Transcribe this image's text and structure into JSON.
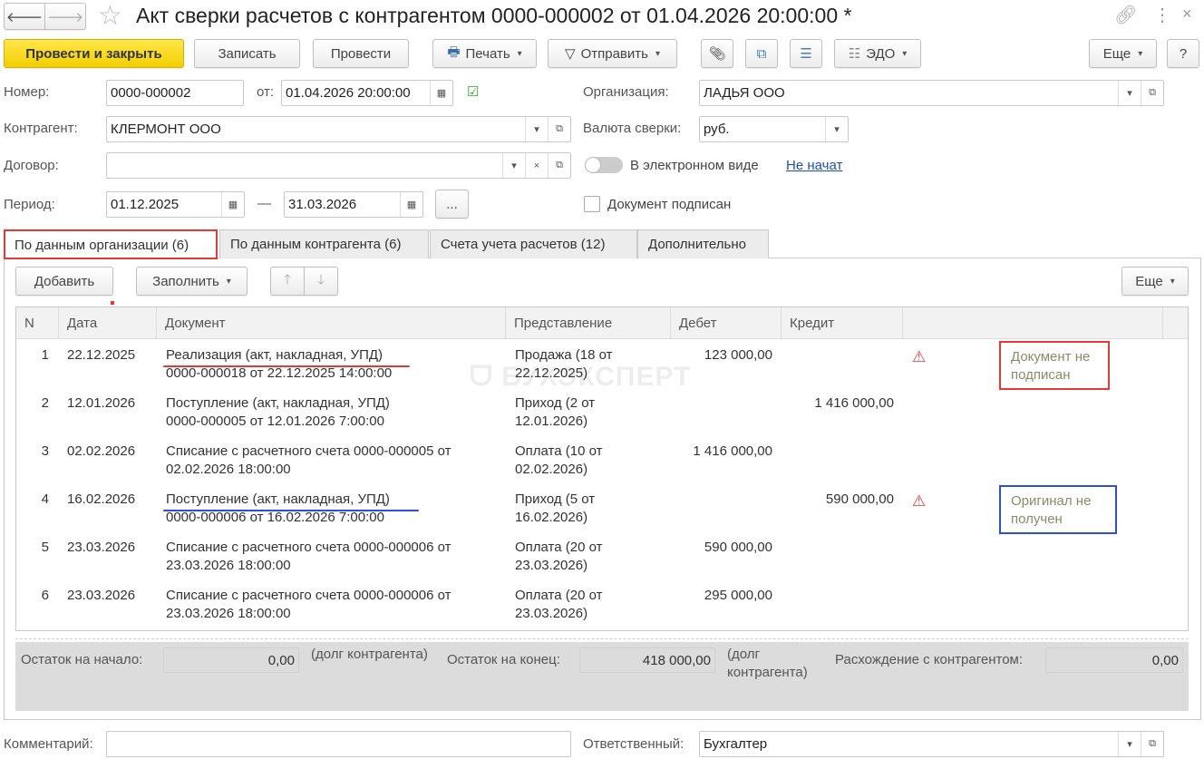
{
  "window": {
    "title": "Акт сверки расчетов с контрагентом 0000-000002 от 01.04.2026 20:00:00 *"
  },
  "toolbar": {
    "post_close": "Провести и закрыть",
    "save": "Записать",
    "post": "Провести",
    "print": "Печать",
    "send": "Отправить",
    "edo": "ЭДО",
    "more": "Еще",
    "help": "?"
  },
  "form": {
    "number_label": "Номер:",
    "number": "0000-000002",
    "date_label": "от:",
    "date": "01.04.2026 20:00:00",
    "org_label": "Организация:",
    "org": "ЛАДЬЯ ООО",
    "counterparty_label": "Контрагент:",
    "counterparty": "КЛЕРМОНТ ООО",
    "currency_label": "Валюта сверки:",
    "currency": "руб.",
    "contract_label": "Договор:",
    "contract": "",
    "electronic_label": "В электронном виде",
    "electronic_status": "Не начат",
    "period_label": "Период:",
    "period_from": "01.12.2025",
    "period_dash": "—",
    "period_to": "31.03.2026",
    "period_btn": "...",
    "signed_label": "Документ подписан"
  },
  "tabs": [
    {
      "label": "По данным организации (6)"
    },
    {
      "label": "По данным контрагента (6)"
    },
    {
      "label": "Счета учета расчетов (12)"
    },
    {
      "label": "Дополнительно"
    }
  ],
  "table_toolbar": {
    "add": "Добавить",
    "fill": "Заполнить",
    "more": "Еще"
  },
  "table": {
    "headers": [
      "N",
      "Дата",
      "Документ",
      "Представление",
      "Дебет",
      "Кредит"
    ],
    "rows": [
      {
        "n": "1",
        "date": "22.12.2025",
        "doc1": "Реализация (акт, накладная, УПД)",
        "doc2": "0000-000018 от 22.12.2025 14:00:00",
        "rep1": "Продажа (18 от",
        "rep2": "22.12.2025)",
        "debit": "123 000,00",
        "credit": "",
        "warn": true,
        "note": "Документ не подписан"
      },
      {
        "n": "2",
        "date": "12.01.2026",
        "doc1": "Поступление (акт, накладная, УПД)",
        "doc2": "0000-000005 от 12.01.2026 7:00:00",
        "rep1": "Приход (2 от",
        "rep2": "12.01.2026)",
        "debit": "",
        "credit": "1 416 000,00"
      },
      {
        "n": "3",
        "date": "02.02.2026",
        "doc1": "Списание с расчетного счета 0000-000005 от",
        "doc2": "02.02.2026 18:00:00",
        "rep1": "Оплата (10 от",
        "rep2": "02.02.2026)",
        "debit": "1 416 000,00",
        "credit": ""
      },
      {
        "n": "4",
        "date": "16.02.2026",
        "doc1": "Поступление (акт, накладная, УПД)",
        "doc2": "0000-000006 от 16.02.2026 7:00:00",
        "rep1": "Приход (5 от",
        "rep2": "16.02.2026)",
        "debit": "",
        "credit": "590 000,00",
        "warn": true,
        "note": "Оригинал не получен"
      },
      {
        "n": "5",
        "date": "23.03.2026",
        "doc1": "Списание с расчетного счета 0000-000006 от",
        "doc2": "23.03.2026 18:00:00",
        "rep1": "Оплата (20 от",
        "rep2": "23.03.2026)",
        "debit": "590 000,00",
        "credit": ""
      },
      {
        "n": "6",
        "date": "23.03.2026",
        "doc1": "Списание с расчетного счета 0000-000006 от",
        "doc2": "23.03.2026 18:00:00",
        "rep1": "Оплата (20 от",
        "rep2": "23.03.2026)",
        "debit": "295 000,00",
        "credit": ""
      }
    ]
  },
  "totals": {
    "start_label": "Остаток на начало:",
    "start": "0,00",
    "start_note": "(долг контрагента)",
    "end_label": "Остаток на конец:",
    "end": "418 000,00",
    "end_note": "(долг контрагента)",
    "diff_label": "Расхождение с контрагентом:",
    "diff": "0,00"
  },
  "bottom": {
    "comment_label": "Комментарий:",
    "comment": "",
    "responsible_label": "Ответственный:",
    "responsible": "Бухгалтер"
  },
  "watermark": "БУХЭКСПЕРТ",
  "colors": {
    "primary": "#f5d400",
    "link": "#1a4fbf",
    "red_mark": "#e53935",
    "blue_mark": "#2a4fe0"
  }
}
